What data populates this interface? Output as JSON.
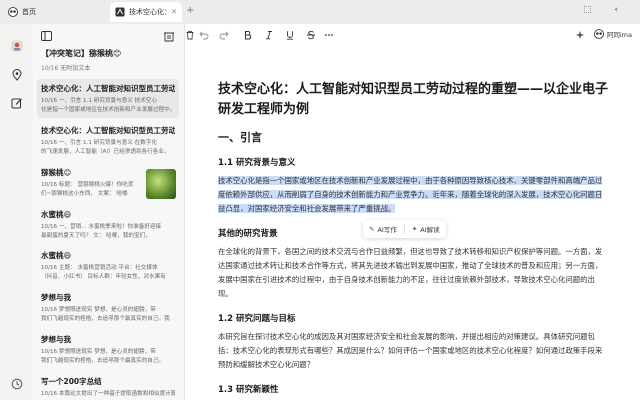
{
  "tabs": [
    {
      "title": "首页",
      "close": ""
    },
    {
      "title": "技术空心化：",
      "close": "✕"
    }
  ],
  "new_tab": "+",
  "window_controls": "⬚ ‹",
  "account": {
    "name": "阿同ima"
  },
  "notebook": {
    "title": "【冲突笔记】猕猴桃😊",
    "meta": "10/16 无附加文本"
  },
  "notes": [
    {
      "title": "技术空心化：人工智能对知识型员工劳动过程的重",
      "line1": "10/16 一、引言     1.1 研究背景与意义     技术空心",
      "line2": "化是指一个国家或地区在技术创新和产业发展过程中，"
    },
    {
      "title": "技术空心化：人工智能对知识型员工劳动过程",
      "line1": "10/16 一、引言     1.1 研究背景与意义     在数字化",
      "line2": "的飞速发展，人工智能（AI）已经渗透到各行各业，"
    },
    {
      "title": "猕猴桃😊",
      "line1": "10/16 标题：    营猕猴桃火爆！你吃货",
      "line2": "们~猕猴桃这小东西，    文案：     哈喽"
    },
    {
      "title": "水蜜桃😄",
      "line1": "10/16 一、营销...    水蜜桃季来啦！你准备好迎接",
      "line2": "最甜蜜的夏天了吗？    文：    哈喽，我的宝们，"
    },
    {
      "title": "水蜜桃😄",
      "line1": "10/16 主题：    水蜜桃营销活动     平台：社交媒体",
      "line2": "（抖音、小红书）    目标人群：年轻女性，对水果有"
    },
    {
      "title": "梦想与我",
      "line1": "10/16 梦想照进现实     梦想，是心灵的翅膀，带",
      "line2": "我们飞越现实的桎梏，去追寻那个最真实的自己。我"
    },
    {
      "title": "梦想与我",
      "line1": "10/16 梦想照进现实     梦想，是心灵的翅膀，带",
      "line2": "我们飞越现实的桎梏，去追寻那个最真实的自己。"
    },
    {
      "title": "写一个200字总结",
      "line1": "10/16 本篇论文提出了一种基于提取函数和相似度计算",
      "line2": ""
    }
  ],
  "doc": {
    "title": "技术空心化：人工智能对知识型员工劳动过程的重塑——以企业电子研发工程师为例",
    "s1": "一、引言",
    "s1_1": "1.1 研究背景与意义",
    "p1": "技术空心化是指一个国家或地区在技术创新和产业发展过程中，由于各种原因导致核心技术、关键零部件和高端产品过度依赖外部供应，从而削弱了自身的技术创新能力和产业竞争力。近年来，随着全球化的深入发展，技术空心化问题日益凸显，对国家经济安全和社会发展带来了严重挑战。",
    "s_bg": "其他的研究背景",
    "p2": "在全球化的背景下，各国之间的技术交流与合作日益频繁，但这也导致了技术转移和知识产权保护等问题。一方面，发达国家通过技术转让和技术合作等方式，将其先进技术输出到发展中国家，推动了全球技术的普及和应用；另一方面，发展中国家在引进技术的过程中，由于自身技术创新能力的不足，往往过度依赖外部技术，导致技术空心化问题的出现。",
    "s1_2": "1.2 研究问题与目标",
    "p3": "本研究旨在探讨技术空心化的成因及其对国家经济安全和社会发展的影响，并提出相应的对策建议。具体研究问题包括：技术空心化的表现形式有哪些？其成因是什么？如何评估一个国家或地区的技术空心化程度？如何通过政策手段来预防和缓解技术空心化问题？",
    "s1_3": "1.3 研究新颖性"
  },
  "ai_popup": {
    "write": "AI写作",
    "interpret": "AI解读"
  },
  "icons": [
    "panda-logo-icon",
    "doc-favicon-icon",
    "sidebar-toggle-icon",
    "trash-icon",
    "undo-icon",
    "redo-icon",
    "bold-icon",
    "italic-icon",
    "underline-icon",
    "strikethrough-icon",
    "more-icon",
    "location-icon",
    "edit-icon",
    "history-icon",
    "sparkle-icon"
  ],
  "colors": {
    "selection": "#c9dcf8",
    "background": "#f3f3f1",
    "editor": "#ffffff"
  }
}
